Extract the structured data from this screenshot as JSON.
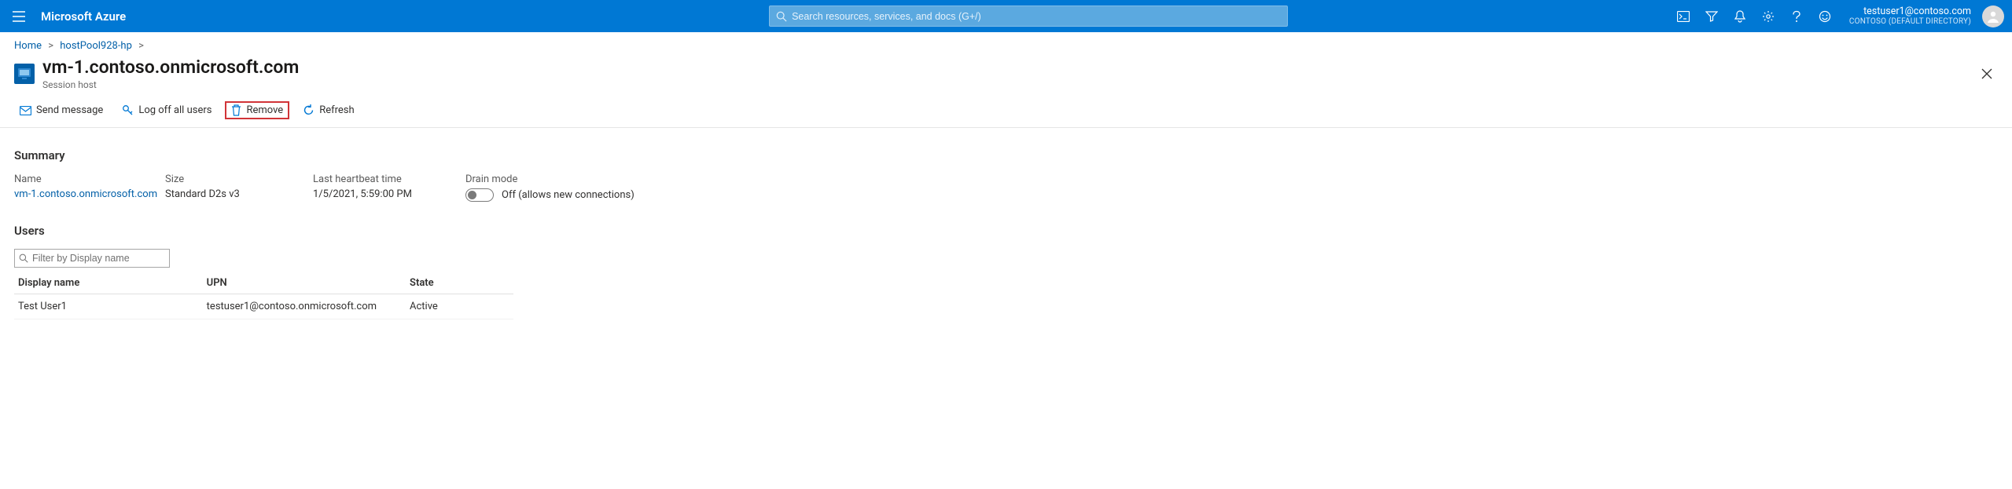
{
  "brand": "Microsoft Azure",
  "search": {
    "placeholder": "Search resources, services, and docs (G+/)"
  },
  "account": {
    "email": "testuser1@contoso.com",
    "directory": "CONTOSO (DEFAULT DIRECTORY)"
  },
  "breadcrumbs": {
    "home": "Home",
    "hostpool": "hostPool928-hp"
  },
  "title": {
    "main": "vm-1.contoso.onmicrosoft.com",
    "sub": "Session host"
  },
  "commands": {
    "send_message": "Send message",
    "log_off": "Log off all users",
    "remove": "Remove",
    "refresh": "Refresh"
  },
  "summary": {
    "heading": "Summary",
    "name_label": "Name",
    "name_value": "vm-1.contoso.onmicrosoft.com",
    "size_label": "Size",
    "size_value": "Standard D2s v3",
    "heartbeat_label": "Last heartbeat time",
    "heartbeat_value": "1/5/2021, 5:59:00 PM",
    "drain_label": "Drain mode",
    "drain_status": "Off (allows new connections)"
  },
  "users": {
    "heading": "Users",
    "filter_placeholder": "Filter by Display name",
    "columns": {
      "display_name": "Display name",
      "upn": "UPN",
      "state": "State"
    },
    "rows": [
      {
        "display_name": "Test User1",
        "upn": "testuser1@contoso.onmicrosoft.com",
        "state": "Active"
      }
    ]
  }
}
